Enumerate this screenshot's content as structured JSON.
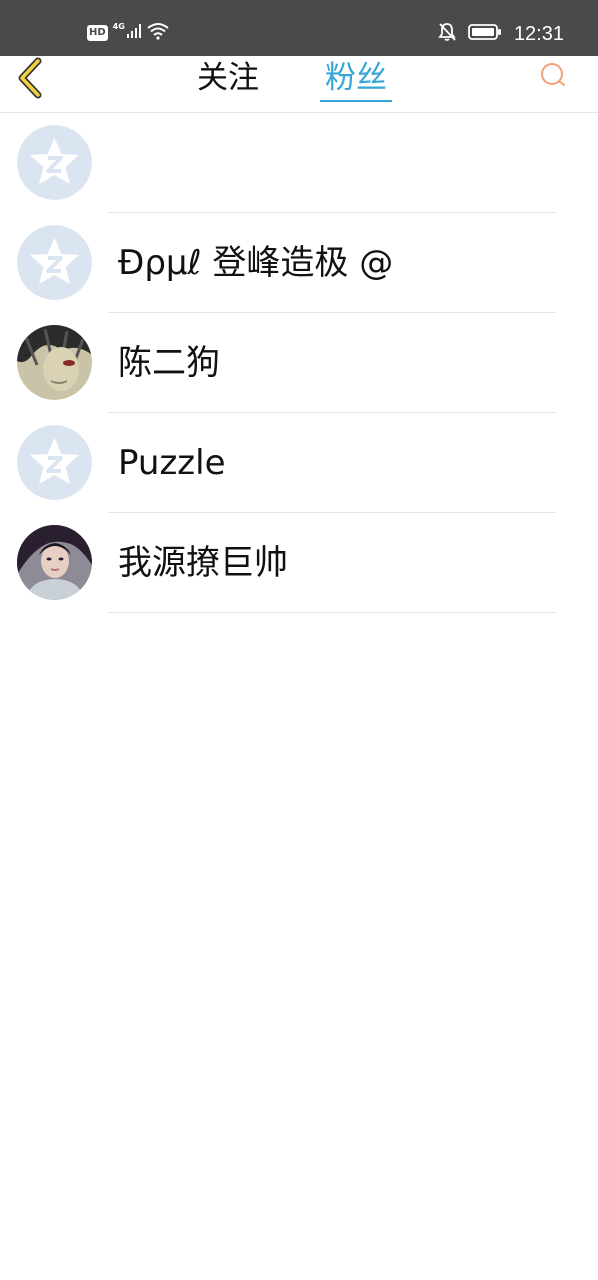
{
  "status_bar": {
    "hd_label": "HD",
    "network_label": "4G",
    "time": "12:31",
    "icons": [
      "signal-icon",
      "wifi-icon",
      "bell-muted-icon",
      "battery-icon"
    ]
  },
  "nav": {
    "back_icon": "chevron-left-icon",
    "tabs": [
      {
        "label": "关注",
        "active": false
      },
      {
        "label": "粉丝",
        "active": true
      }
    ],
    "search_icon": "search-icon",
    "colors": {
      "active_tab": "#35a6d6",
      "back_icon_fill": "#f5d23a",
      "search_icon": "#f2a07b"
    }
  },
  "fans": [
    {
      "name": "",
      "avatar": "default-qzone-avatar"
    },
    {
      "name": "Ɖρµℓ 登峰造极 @",
      "avatar": "default-qzone-avatar"
    },
    {
      "name": "陈二狗",
      "avatar": "anime-portrait-avatar"
    },
    {
      "name": "Puzzle",
      "avatar": "default-qzone-avatar"
    },
    {
      "name": "我源撩巨帅",
      "avatar": "photo-portrait-avatar"
    }
  ]
}
